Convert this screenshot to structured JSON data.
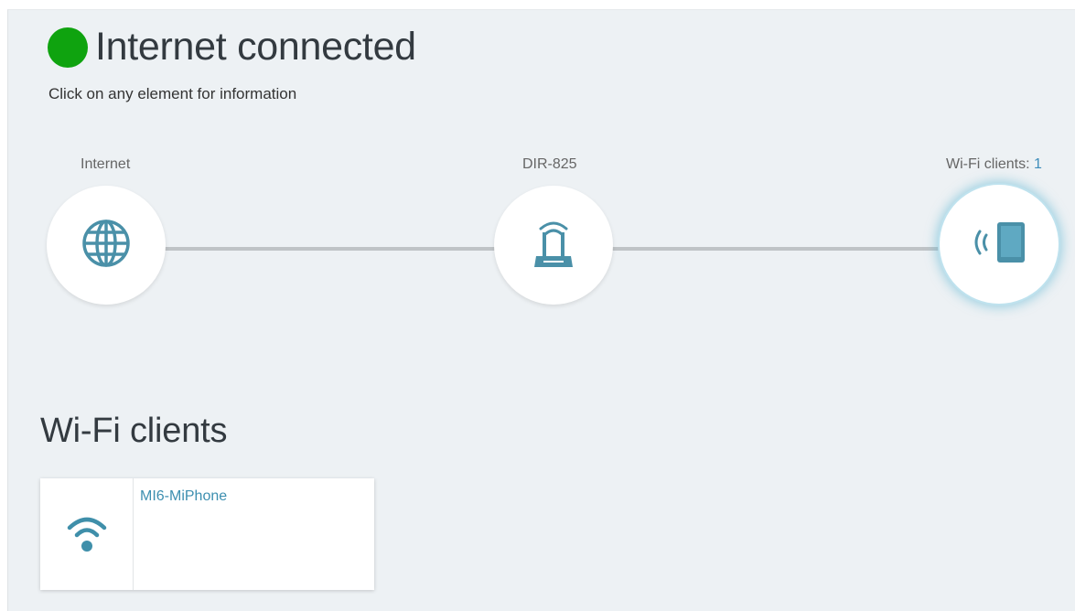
{
  "status": {
    "title": "Internet connected",
    "dot_color": "#0fa30f",
    "hint": "Click on any element for information"
  },
  "topology": {
    "internet": {
      "label": "Internet",
      "icon": "globe-icon"
    },
    "router": {
      "label": "DIR-825",
      "icon": "router-icon"
    },
    "wifi_clients": {
      "label": "Wi-Fi clients: ",
      "count": "1",
      "icon": "wireless-tablet-icon"
    }
  },
  "wifi_section": {
    "title": "Wi-Fi clients",
    "clients": [
      {
        "name": "MI6-MiPhone",
        "icon": "wifi-signal-icon"
      }
    ]
  },
  "colors": {
    "accent": "#3d8fb0",
    "icon": "#4a90a8",
    "panel_bg": "#edf1f4"
  }
}
